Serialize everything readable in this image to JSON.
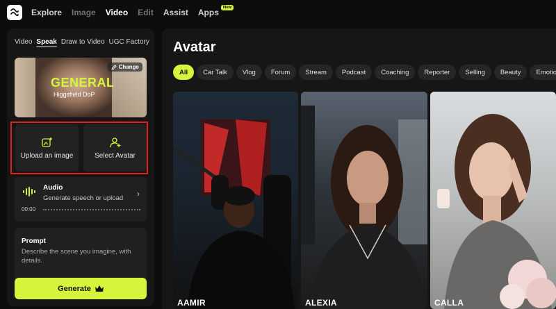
{
  "nav": {
    "logo_icon": "higgsfield-logo-icon",
    "items": [
      {
        "label": "Explore",
        "state": "normal"
      },
      {
        "label": "Image",
        "state": "dim"
      },
      {
        "label": "Video",
        "state": "active"
      },
      {
        "label": "Edit",
        "state": "dim"
      },
      {
        "label": "Assist",
        "state": "normal"
      },
      {
        "label": "Apps",
        "state": "normal"
      }
    ],
    "apps_badge": "New"
  },
  "left": {
    "subtabs": [
      "Video",
      "Speak",
      "Draw to Video",
      "UGC Factory"
    ],
    "active_subtab": "Speak",
    "preview": {
      "title": "GENERAL",
      "subtitle": "Higgsfield DoP",
      "change_label": "Change"
    },
    "upload_label": "Upload an image",
    "select_avatar_label": "Select Avatar",
    "audio": {
      "title": "Audio",
      "subtitle": "Generate speech or upload",
      "time": "00:00"
    },
    "prompt": {
      "title": "Prompt",
      "placeholder": "Describe the scene you imagine, with details."
    },
    "generate_label": "Generate"
  },
  "main": {
    "title": "Avatar",
    "chips": [
      "All",
      "Car Talk",
      "Vlog",
      "Forum",
      "Stream",
      "Podcast",
      "Coaching",
      "Reporter",
      "Selling",
      "Beauty",
      "Emotions"
    ],
    "active_chip": "All",
    "avatars": [
      "AAMIR",
      "ALEXIA",
      "CALLA"
    ]
  },
  "colors": {
    "accent": "#d4f53c",
    "highlight": "#e1231b",
    "panel": "#161616",
    "background": "#0d0d0d"
  }
}
